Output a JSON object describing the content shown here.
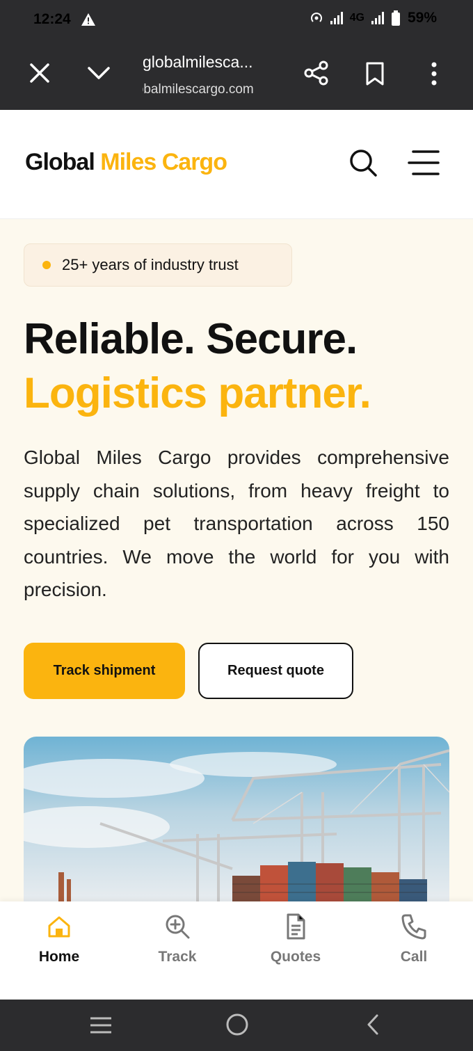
{
  "status_bar": {
    "time": "12:24",
    "network": "4G",
    "battery": "59%"
  },
  "browser": {
    "page_title": "globalmilesca...",
    "url": "globalmilescargo.com"
  },
  "site": {
    "logo_part1": "Global",
    "logo_part2": "Miles Cargo",
    "accent_color": "#fbb40f"
  },
  "hero": {
    "badge": "25+ years of industry trust",
    "headline_line1": "Reliable. Secure.",
    "headline_line2": "Logistics partner.",
    "description": "Global Miles Cargo provides comprehensive supply chain solutions, from heavy freight to specialized pet transportation across 150 countries. We move the world for you with precision.",
    "primary_button": "Track shipment",
    "secondary_button": "Request quote"
  },
  "bottom_nav": {
    "items": [
      {
        "label": "Home",
        "icon": "home-icon",
        "active": true
      },
      {
        "label": "Track",
        "icon": "track-search-icon",
        "active": false
      },
      {
        "label": "Quotes",
        "icon": "document-icon",
        "active": false
      },
      {
        "label": "Call",
        "icon": "phone-icon",
        "active": false
      }
    ]
  }
}
